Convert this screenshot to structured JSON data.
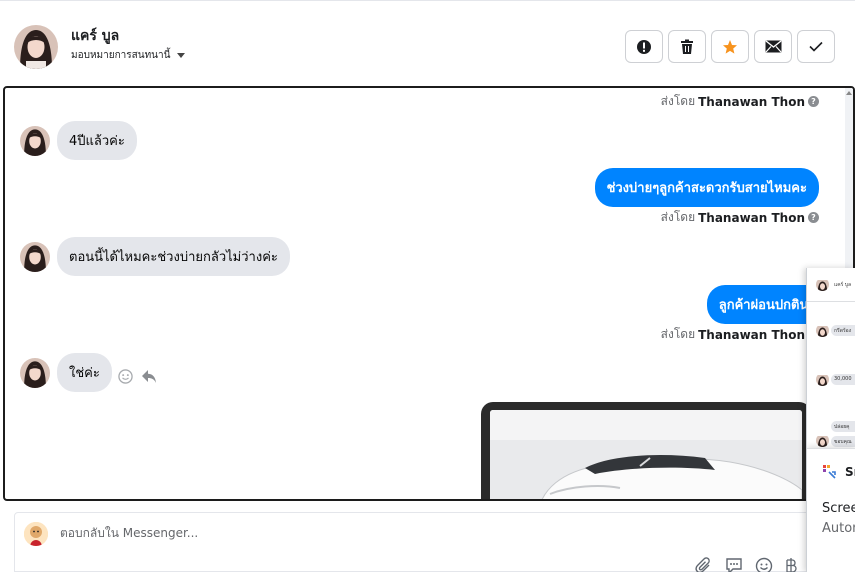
{
  "header": {
    "contact_name": "แคร์ บูล",
    "assign_label": "มอบหมายการสนทนานี้",
    "actions": [
      {
        "icon": "alert-icon"
      },
      {
        "icon": "trash-icon"
      },
      {
        "icon": "star-icon",
        "color": "#f7931e"
      },
      {
        "icon": "mail-icon"
      },
      {
        "icon": "check-icon"
      }
    ]
  },
  "thread": {
    "sent_by_prefix": "ส่งโดย",
    "messages": [
      {
        "type": "sent_by",
        "name": "Thanawan Thon"
      },
      {
        "type": "incoming",
        "text": "4ปีแล้วค่ะ"
      },
      {
        "type": "outgoing",
        "text": "ช่วงบ่ายๆลูกค้าสะดวกรับสายไหมคะ"
      },
      {
        "type": "sent_by",
        "name": "Thanawan Thon"
      },
      {
        "type": "incoming",
        "text": "ตอนนี้ได้ไหมคะช่วงบ่ายกลัวไม่ว่างค่ะ"
      },
      {
        "type": "outgoing",
        "text": "ลูกค้าผ่อนปกตินะคะ"
      },
      {
        "type": "sent_by",
        "name": "Thanawan Thon"
      },
      {
        "type": "incoming",
        "text": "ใช่ค่ะ"
      },
      {
        "type": "image",
        "description": "car photo"
      }
    ],
    "outgoing_color": "#0084ff"
  },
  "composer": {
    "placeholder": "ตอบกลับใน Messenger..."
  },
  "overlay": {
    "mini_messages": [
      "แคร์ บูล",
      "กรีดร้อง",
      "30,000",
      "ปล่อยคุ",
      "ขอบคุณ"
    ],
    "panel_title": "Sn",
    "line1": "Scree",
    "line2": "Auton"
  }
}
